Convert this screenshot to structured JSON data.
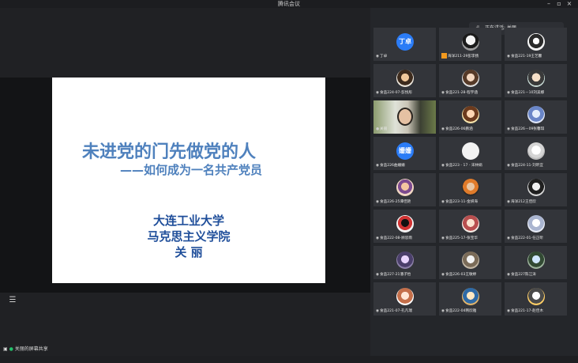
{
  "window": {
    "title": "腾讯会议",
    "min": "–",
    "max": "▫",
    "close": "×"
  },
  "slide": {
    "title": "未进党的门先做党的人",
    "subtitle": "——如何成为一名共产党员",
    "line1": "大连工业大学",
    "line2": "马克思主义学院",
    "line3": "关 丽"
  },
  "share_status": {
    "text": "关丽的屏幕共享"
  },
  "speaker": {
    "label": "正在讲话: 关丽"
  },
  "participants": [
    {
      "name": "丁卓",
      "avatar_text": "丁卓",
      "style": "blue"
    },
    {
      "name": "海洋211-29彭李扬",
      "avatar_text": "",
      "style": "p1",
      "badge": "orange"
    },
    {
      "name": "食品221-19王艺馨",
      "avatar_text": "",
      "style": "p9"
    },
    {
      "name": "食品224-07-彭悦彤",
      "avatar_text": "",
      "style": "p2"
    },
    {
      "name": "食品221-28-程宇涵",
      "avatar_text": "",
      "style": "p3"
    },
    {
      "name": "食品221－10刘美娜",
      "avatar_text": "",
      "style": "p4"
    },
    {
      "name": "关丽",
      "avatar_text": "",
      "style": "video",
      "badge": "green"
    },
    {
      "name": "食品226-06鹏涵",
      "avatar_text": "",
      "style": "p5"
    },
    {
      "name": "食品226－09张馨琪",
      "avatar_text": "",
      "style": "p6"
    },
    {
      "name": "食品226曲姗姗",
      "avatar_text": "姗姗",
      "style": "blue"
    },
    {
      "name": "食品223 - 17 - 宋林娟",
      "avatar_text": "",
      "style": "white"
    },
    {
      "name": "食品224-11-刘昕宜",
      "avatar_text": "",
      "style": "p7"
    },
    {
      "name": "食品226-25谭佳艳",
      "avatar_text": "",
      "style": "p11"
    },
    {
      "name": "食品223-11-金妍海",
      "avatar_text": "",
      "style": "p8"
    },
    {
      "name": "海洋212王佳欣",
      "avatar_text": "",
      "style": "p22"
    },
    {
      "name": "食品222-08-顾思雨",
      "avatar_text": "",
      "style": "p10"
    },
    {
      "name": "食品225-17-张宝华",
      "avatar_text": "",
      "style": "p16"
    },
    {
      "name": "食品222-01-任正昕",
      "avatar_text": "",
      "style": "p12"
    },
    {
      "name": "食品227-21潘子怡",
      "avatar_text": "",
      "style": "p13"
    },
    {
      "name": "食品226-03王敏婷",
      "avatar_text": "",
      "style": "p14"
    },
    {
      "name": "食品227陈江涛",
      "avatar_text": "",
      "style": "p15"
    },
    {
      "name": "食品221-07-孔凡瑞",
      "avatar_text": "",
      "style": "p19"
    },
    {
      "name": "食品222-04韩欣雅",
      "avatar_text": "",
      "style": "p17"
    },
    {
      "name": "食品221-17-赵佳木",
      "avatar_text": "",
      "style": "p20"
    }
  ]
}
